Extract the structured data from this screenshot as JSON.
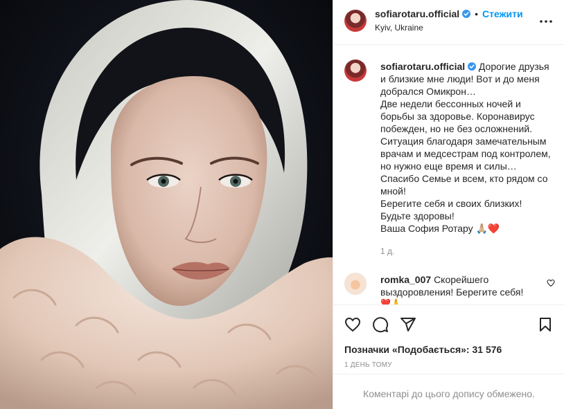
{
  "post": {
    "photo_alt": "",
    "account": "sofiarotaru.official",
    "follow_label": "Стежити",
    "separator": "•",
    "location": "Kyiv, Ukraine"
  },
  "caption": {
    "username": "sofiarotaru.official",
    "lines": [
      "Дорогие друзья и близкие мне люди! Вот и до меня добрался Омикрон…",
      "Две недели бессонных ночей и борьбы за здоровье. Коронавирус побежден, но не без осложнений.",
      "Ситуация благодаря замечательным врачам и медсестрам под контролем, но нужно еще время и силы…",
      "Спасибо Семье и всем, кто рядом со мной!",
      "Берегите себя и своих близких!",
      "Будьте здоровы!",
      "Ваша София Ротару 🙏🏼❤️"
    ],
    "time": "1 д."
  },
  "comment": {
    "username": "romka_007",
    "text": "Скорейшего выздоровления! Берегите себя!",
    "emoji": "❤️🙏"
  },
  "likes": {
    "label": "Позначки «Подобається»:",
    "count": "31 576"
  },
  "posted": "1 ДЕНЬ ТОМУ",
  "footer": "Коментарі до цього допису обмежено.",
  "icons": {
    "like": "heart-icon",
    "comment": "comment-icon",
    "share": "send-icon",
    "save": "bookmark-icon",
    "more": "more-icon",
    "verified": "verified-icon"
  },
  "colors": {
    "link": "#0095f6",
    "verified": "#3897f0",
    "muted": "#8e8e8e",
    "heart": "#ed4956"
  }
}
